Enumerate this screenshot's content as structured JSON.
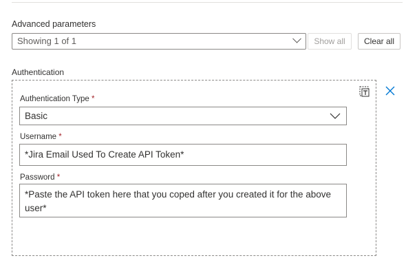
{
  "advanced": {
    "label": "Advanced parameters",
    "value": "Showing 1 of 1",
    "show_all": "Show all",
    "clear_all": "Clear all"
  },
  "auth": {
    "label": "Authentication",
    "type_label": "Authentication Type",
    "type_value": "Basic",
    "username_label": "Username",
    "username_value": "*Jira Email Used To Create API Token*",
    "password_label": "Password",
    "password_value": "*Paste the API token here that you coped after you created it for the above user*",
    "required_mark": "*"
  }
}
